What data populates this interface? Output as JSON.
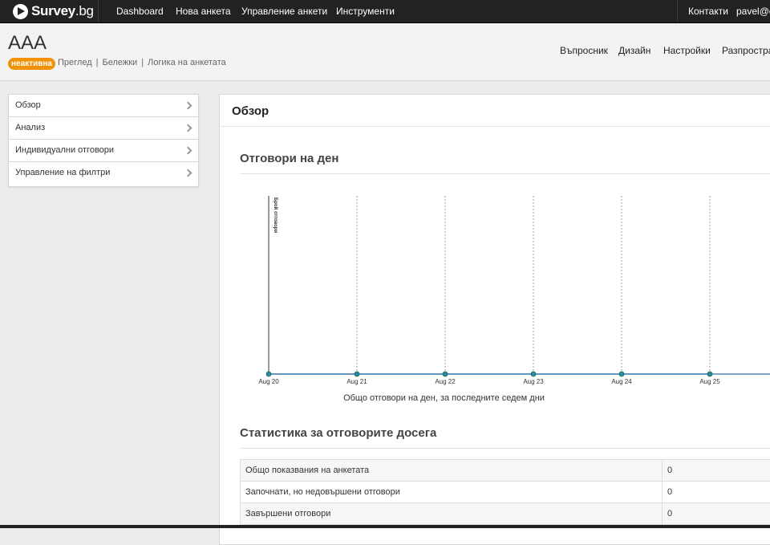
{
  "brand": {
    "name_bold": "Survey",
    "name_light": ".bg"
  },
  "topnav": {
    "items": [
      "Dashboard",
      "Нова анкета",
      "Управление анкети",
      "Инструменти"
    ],
    "contacts": "Контакти",
    "user": "pavel@ca"
  },
  "survey": {
    "title": "AAA",
    "status_badge": "неактивна",
    "links": [
      "Преглед",
      "Бележки",
      "Логика на анкетата"
    ],
    "link_sep": "|",
    "tabs": [
      "Въпросник",
      "Дизайн",
      "Настройки",
      "Разпростра"
    ]
  },
  "sidebar": {
    "items": [
      {
        "label": "Обзор"
      },
      {
        "label": "Анализ"
      },
      {
        "label": "Индивидуални отговори"
      },
      {
        "label": "Управление на филтри"
      }
    ]
  },
  "main": {
    "title": "Обзор",
    "responses_title": "Отговори на ден",
    "stats_title": "Статистика за отговорите досега",
    "stats": [
      {
        "label": "Общо показвания на анкетата",
        "value": "0"
      },
      {
        "label": "Започнати, но недовършени отговори",
        "value": "0"
      },
      {
        "label": "Завършени отговори",
        "value": "0"
      }
    ]
  },
  "chart_data": {
    "type": "line",
    "categories": [
      "Aug 20",
      "Aug 21",
      "Aug 22",
      "Aug 23",
      "Aug 24",
      "Aug 25"
    ],
    "values": [
      0,
      0,
      0,
      0,
      0,
      0
    ],
    "title": "",
    "xlabel": "Общо отговори на ден, за последните седем дни",
    "ylabel": "Брой отговори",
    "grid": "vertical dashed",
    "line_color": "#2a6ea6",
    "marker_color": "#2a8aa0"
  }
}
